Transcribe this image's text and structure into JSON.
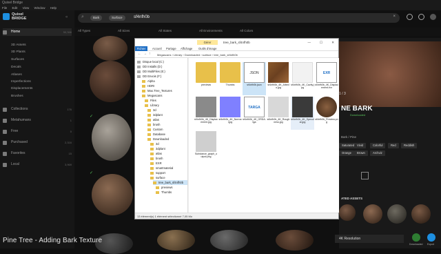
{
  "app": {
    "title": "Quixel Bridge",
    "menu": [
      "File",
      "Edit",
      "View",
      "Window",
      "Help"
    ]
  },
  "sidebar": {
    "logo_line1": "Quixel",
    "logo_line2": "BRIDGE",
    "home": {
      "label": "Home",
      "count": "50,346"
    },
    "subitems": [
      "3D Assets",
      "3D Plants",
      "Surfaces",
      "Decals",
      "Atlases",
      "Imperfections",
      "Displacements",
      "Brushes"
    ],
    "nav": [
      {
        "label": "Collections",
        "count": "176"
      },
      {
        "label": "Metahumans",
        "count": "1"
      },
      {
        "label": "Free",
        "count": "0"
      },
      {
        "label": "Purchased",
        "count": "2,316"
      },
      {
        "label": "Favorites",
        "count": "15"
      },
      {
        "label": "Local",
        "count": "3,969"
      }
    ]
  },
  "search": {
    "chips": [
      "Bark",
      "Surface"
    ],
    "query": "sf4nfh0b"
  },
  "filters": [
    "All Types",
    "All Sizes",
    "All States",
    "All Environments",
    "All Colors"
  ],
  "explorer": {
    "ribbon_button": "Gérer",
    "window_title": "tree_bark_sf4nfh0b",
    "tabs": [
      "Fichier",
      "Accueil",
      "Partage",
      "Affichage",
      "Outils d'image"
    ],
    "breadcrumb": [
      "Megascans",
      "Library",
      "Downloaded",
      "surface",
      "tree_bark_sf4nfh0b"
    ],
    "tree": [
      "Disque local (C:)",
      "DD Installs (D:)",
      "DD MultiFiles (E:)",
      "DD Envois (F:)",
      "Alpha",
      "HDRI",
      "Max.Tree_Textures",
      "Megascans",
      "Files",
      "Library",
      "3d",
      "3dplant",
      "atlas",
      "brush",
      "Custom",
      "Database",
      "Downloaded",
      "3d",
      "3dplant",
      "atlas",
      "brush",
      "EXR",
      "smartmaterial",
      "support",
      "surface",
      "tree_bark_sf4nfh0b",
      "previews",
      "Thumbs"
    ],
    "files": [
      {
        "name": "previews",
        "kind": "folder"
      },
      {
        "name": "Thumbs",
        "kind": "folder"
      },
      {
        "name": "sf4nfh0b.json",
        "kind": "json"
      },
      {
        "name": "sf4nfh0b_4K_Albedo.jpg",
        "kind": "albedo"
      },
      {
        "name": "sf4nfh0b_4K_Cavity.jpg",
        "kind": "white"
      },
      {
        "name": "sf4nfh0b_4K_Displacement.exr",
        "kind": "exr"
      },
      {
        "name": "sf4nfh0b_4K_Displacement.jpg",
        "kind": "gray"
      },
      {
        "name": "sf4nfh0b_4K_Normal.jpg",
        "kind": "normal"
      },
      {
        "name": "sf4nfh0b_4K_ORDA.tga",
        "kind": "targa"
      },
      {
        "name": "sf4nfh0b_4K_Roughness.jpg",
        "kind": "light"
      },
      {
        "name": "sf4nfh0b_4K_Specular.jpg",
        "kind": "dark"
      },
      {
        "name": "sf4nfh0b_Preview.png",
        "kind": "preview"
      },
      {
        "name": "Substance_graph_output.png",
        "kind": "light"
      }
    ],
    "status": "13 élément(s)   1 élément sélectionné  7,05 Mo"
  },
  "asset_panel": {
    "counter": "1 / 3",
    "title": "NE BARK",
    "tags_label": "Bark / Pine",
    "tags": [
      "Saturated",
      "Vivid",
      "Colorful",
      "Red",
      "Reddish",
      "Orange",
      "Brown",
      "Archviz"
    ],
    "related": "ATED ASSETS",
    "resolution": "4K Resolution",
    "downloaded": "Downloaded",
    "export": "Export"
  },
  "subtitle": "Pine Tree - Adding Bark Texture"
}
